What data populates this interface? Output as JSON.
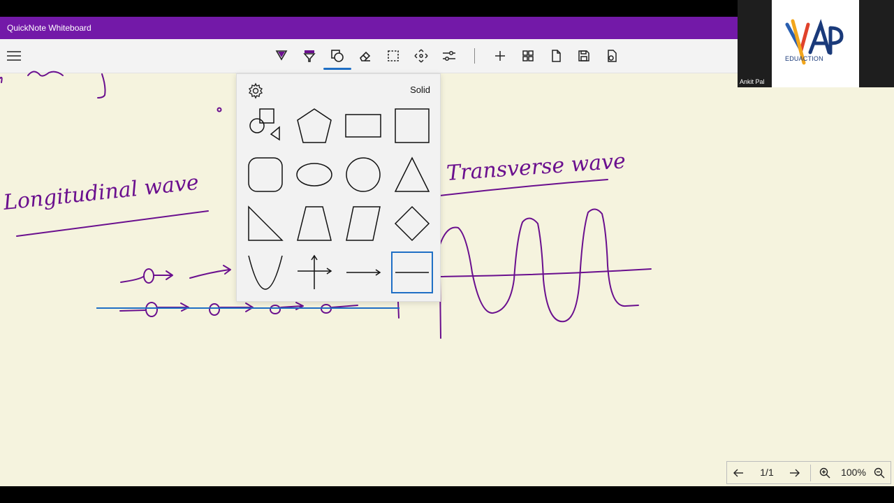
{
  "app": {
    "title": "QuickNote Whiteboard"
  },
  "panel": {
    "mode_label": "Solid"
  },
  "webcam": {
    "presenter_name": "Ankit Pal",
    "logo_text": "EDUACTION"
  },
  "canvas": {
    "handwriting": [
      "Longitudinal wave",
      "Transverse wave"
    ]
  },
  "nav": {
    "page": "1/1",
    "zoom": "100%"
  },
  "colors": {
    "titlebar": "#7319a8",
    "ink": "#6a0f8e",
    "accent": "#1f6fc5",
    "canvas": "#f5f3de"
  },
  "toolbar_icons": [
    "menu-icon",
    "pen-icon",
    "highlighter-icon",
    "shapes-icon",
    "eraser-icon",
    "lasso-select-icon",
    "pan-icon",
    "settings-sliders-icon",
    "add-page-icon",
    "grid-icon",
    "page-icon",
    "save-icon",
    "export-icon"
  ]
}
